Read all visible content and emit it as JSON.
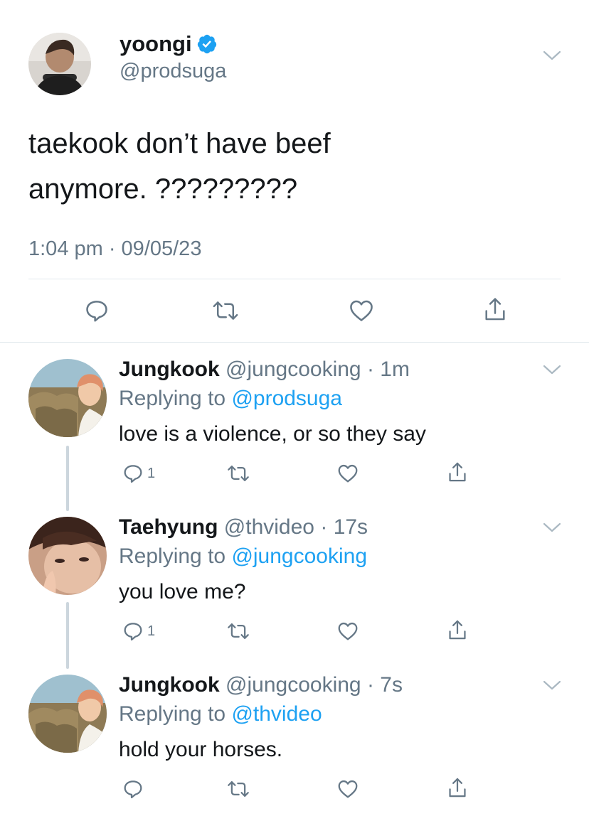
{
  "main_tweet": {
    "display_name": "yoongi",
    "handle": "@prodsuga",
    "verified_icon": "verified-badge-icon",
    "text_line1": "taekook don’t have beef",
    "text_line2": "anymore. ?????????",
    "timestamp": "1:04 pm · 09/05/23"
  },
  "replies": [
    {
      "display_name": "Jungkook",
      "handle": "@jungcooking",
      "dot": "·",
      "time": "1m",
      "replying_prefix": "Replying to",
      "replying_to": "@prodsuga",
      "text": "love is a violence, or so they say",
      "reply_count": "1"
    },
    {
      "display_name": "Taehyung",
      "handle": "@thvideo",
      "dot": "·",
      "time": "17s",
      "replying_prefix": "Replying to",
      "replying_to": "@jungcooking",
      "text": "you love me?",
      "reply_count": "1"
    },
    {
      "display_name": "Jungkook",
      "handle": "@jungcooking",
      "dot": "·",
      "time": "7s",
      "replying_prefix": "Replying to",
      "replying_to": "@thvideo",
      "text": "hold your horses.",
      "reply_count": ""
    }
  ],
  "colors": {
    "accent": "#1da1f2",
    "secondary_text": "#657786",
    "divider": "#e1e8ed"
  },
  "icons": [
    "reply-icon",
    "retweet-icon",
    "like-icon",
    "share-icon",
    "chevron-down-icon",
    "verified-badge-icon"
  ]
}
